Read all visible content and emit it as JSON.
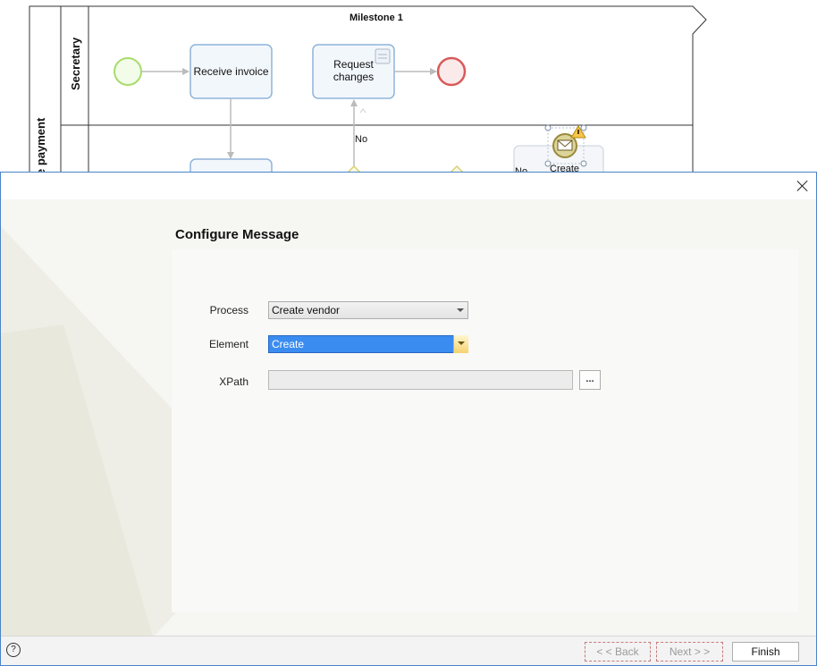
{
  "diagram": {
    "milestone_title": "Milestone 1",
    "pool_label": "e payment",
    "lane_secretary": "Secretary",
    "task_receive": "Receive invoice",
    "task_request_line1": "Request",
    "task_request_line2": "changes",
    "gateway_no_label": "No",
    "create_partial": "Create",
    "no_partial": "No"
  },
  "dialog": {
    "title": "Configure Message",
    "process_label": "Process",
    "process_value": "Create vendor",
    "element_label": "Element",
    "element_value": "Create",
    "xpath_label": "XPath",
    "xpath_value": "",
    "browse_label": "...",
    "help_label": "?",
    "back_label": "< < Back",
    "next_label": "Next > >",
    "finish_label": "Finish"
  },
  "colors": {
    "accent": "#3b8cf0",
    "dialog_border": "#4a84c8",
    "start_event": "#a8dc6c",
    "end_event": "#d85a5a"
  }
}
